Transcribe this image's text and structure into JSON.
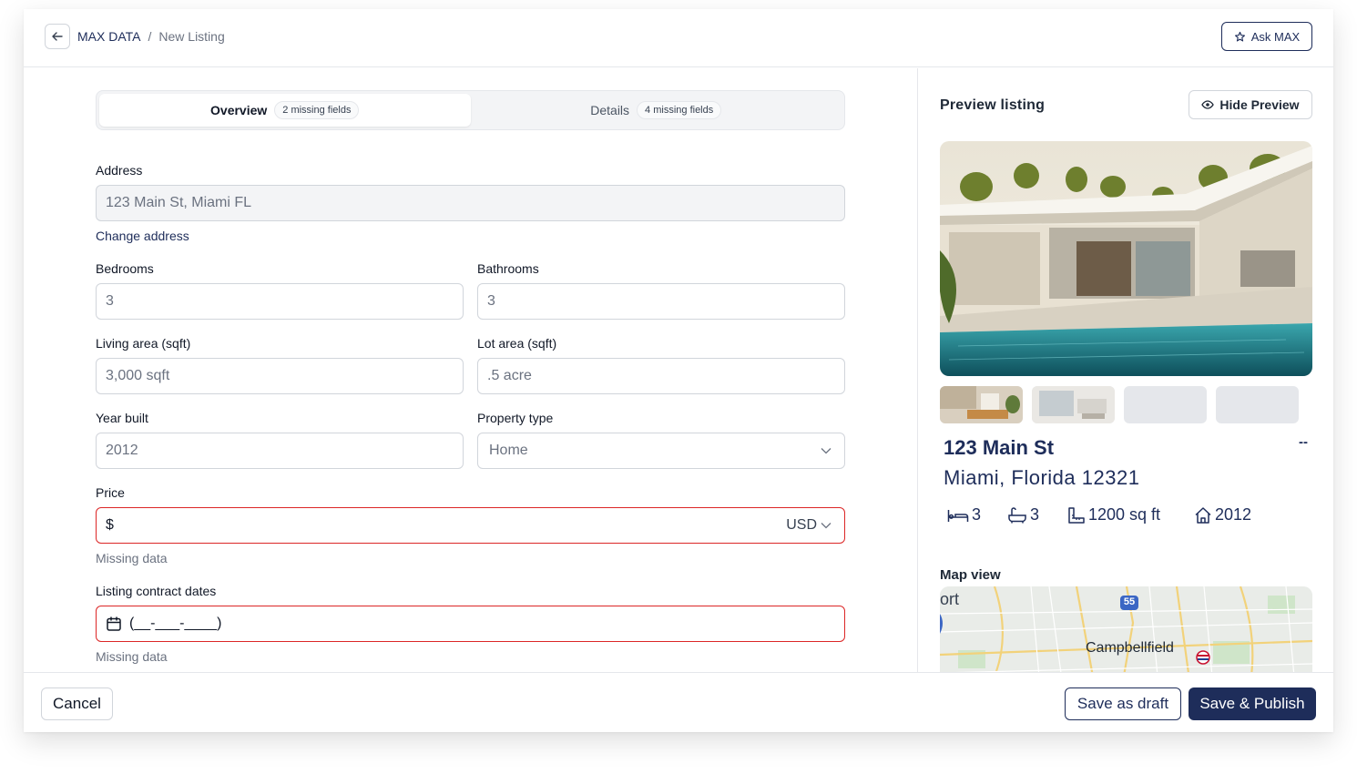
{
  "header": {
    "breadcrumb_root": "MAX DATA",
    "breadcrumb_sep": "/",
    "breadcrumb_current": "New Listing",
    "ask_label": "Ask MAX"
  },
  "tabs": [
    {
      "label": "Overview",
      "badge": "2 missing fields",
      "active": true
    },
    {
      "label": "Details",
      "badge": "4 missing fields",
      "active": false
    }
  ],
  "form": {
    "address_label": "Address",
    "address_value": "123 Main St, Miami FL",
    "change_address": "Change address",
    "bedrooms_label": "Bedrooms",
    "bedrooms_value": "3",
    "bathrooms_label": "Bathrooms",
    "bathrooms_value": "3",
    "living_label": "Living area (sqft)",
    "living_value": "3,000 sqft",
    "lot_label": "Lot area (sqft)",
    "lot_value": ".5 acre",
    "year_label": "Year built",
    "year_value": "2012",
    "type_label": "Property type",
    "type_value": "Home",
    "price_label": "Price",
    "price_prefix": "$",
    "price_currency": "USD",
    "price_error": "Missing data",
    "dates_label": "Listing contract dates",
    "dates_value": "(__-___-____)",
    "dates_error": "Missing data"
  },
  "preview": {
    "title": "Preview listing",
    "hide_label": "Hide Preview",
    "listing_title": "123 Main St",
    "listing_price": "--",
    "listing_location": "Miami, Florida 12321",
    "beds": "3",
    "baths": "3",
    "area": "1200 sq ft",
    "year": "2012",
    "map_title": "Map view",
    "map_label": "Campbellfield",
    "map_label_partial": "ort",
    "map_shield": "55"
  },
  "footer": {
    "cancel": "Cancel",
    "save_draft": "Save as draft",
    "save_publish": "Save & Publish"
  },
  "colors": {
    "brand": "#1e2d5a",
    "error": "#dc2626",
    "border": "#d1d5db"
  }
}
